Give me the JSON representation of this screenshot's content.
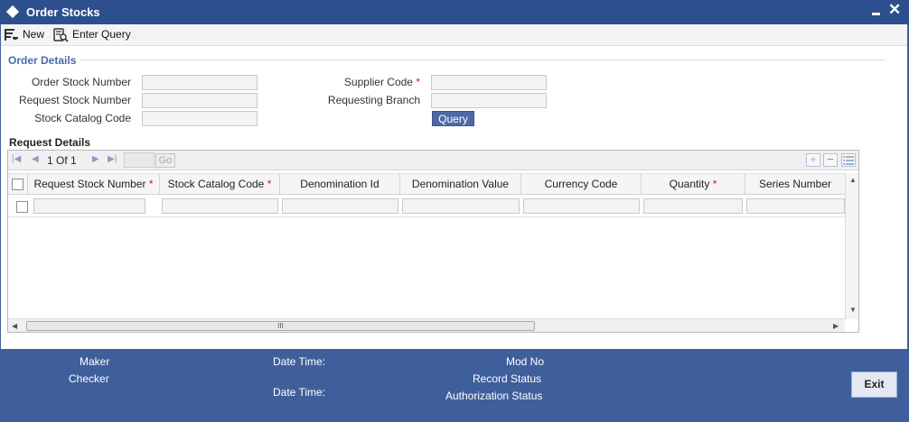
{
  "window": {
    "title": "Order Stocks"
  },
  "toolbar": {
    "new_label": "New",
    "enter_query_label": "Enter Query"
  },
  "order_details": {
    "section_title": "Order Details",
    "order_stock_number": {
      "label": "Order Stock Number",
      "value": ""
    },
    "request_stock_number": {
      "label": "Request Stock Number",
      "value": ""
    },
    "stock_catalog_code": {
      "label": "Stock Catalog Code",
      "value": ""
    },
    "supplier_code": {
      "label": "Supplier Code",
      "required_mark": "*",
      "value": ""
    },
    "requesting_branch": {
      "label": "Requesting Branch",
      "value": ""
    },
    "query_button": "Query"
  },
  "request_details": {
    "title": "Request Details",
    "pager": {
      "page_text": "1 Of 1",
      "go_label": "Go",
      "page_input": ""
    },
    "controls": {
      "add": "+",
      "remove": "−"
    },
    "required_mark": "*",
    "columns": [
      {
        "label": "Request Stock Number",
        "required": true
      },
      {
        "label": "Stock Catalog Code",
        "required": true
      },
      {
        "label": "Denomination Id",
        "required": false
      },
      {
        "label": "Denomination Value",
        "required": false
      },
      {
        "label": "Currency Code",
        "required": false
      },
      {
        "label": "Quantity",
        "required": true
      },
      {
        "label": "Series Number",
        "required": false
      }
    ],
    "hscroll_grip": "III"
  },
  "footer": {
    "maker": "Maker",
    "checker": "Checker",
    "date_time_1": "Date Time:",
    "date_time_2": "Date Time:",
    "mod_no": "Mod No",
    "record_status": "Record Status",
    "authorization_status": "Authorization Status",
    "exit_button": "Exit"
  },
  "colors": {
    "title_bar": "#2e4f8e",
    "footer": "#3f5f9c",
    "accent_button": "#4d6aa6",
    "required": "#d31a1a",
    "section_title": "#4a6aa8"
  },
  "icons": {
    "title": "diamond-icon",
    "new": "new-record-icon",
    "enter_query": "enter-query-icon"
  }
}
